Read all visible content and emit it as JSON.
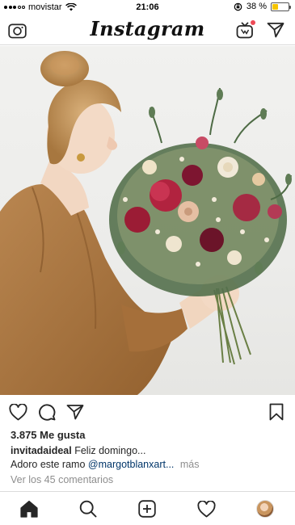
{
  "status_bar": {
    "carrier": "movistar",
    "time": "21:06",
    "battery_text": "38 %",
    "battery_level": 0.38,
    "signal_bars_filled": 3,
    "icons": [
      "wifi-icon",
      "rotation-lock-icon",
      "battery-icon"
    ]
  },
  "header": {
    "logo": "Instagram",
    "left_icon": "camera-icon",
    "right_icons": [
      "igtv-icon",
      "direct-message-icon"
    ],
    "igtv_notification_color": "#ed4956"
  },
  "post": {
    "image_description_icon": "post-photo",
    "actions": [
      "heart-icon",
      "comment-icon",
      "share-icon",
      "bookmark-icon"
    ],
    "likes": "3.875 Me gusta",
    "username": "invitadaideal",
    "caption_line1": "Feliz domingo...",
    "caption_line2_prefix": "Adoro este ramo",
    "caption_mention": "@margotblanxart...",
    "more_label": "más",
    "comments_link": "Ver los 45 comentarios",
    "mention_color": "#003569"
  },
  "tab_bar": {
    "items": [
      "home-icon",
      "search-icon",
      "new-post-icon",
      "activity-icon",
      "profile-avatar"
    ]
  }
}
